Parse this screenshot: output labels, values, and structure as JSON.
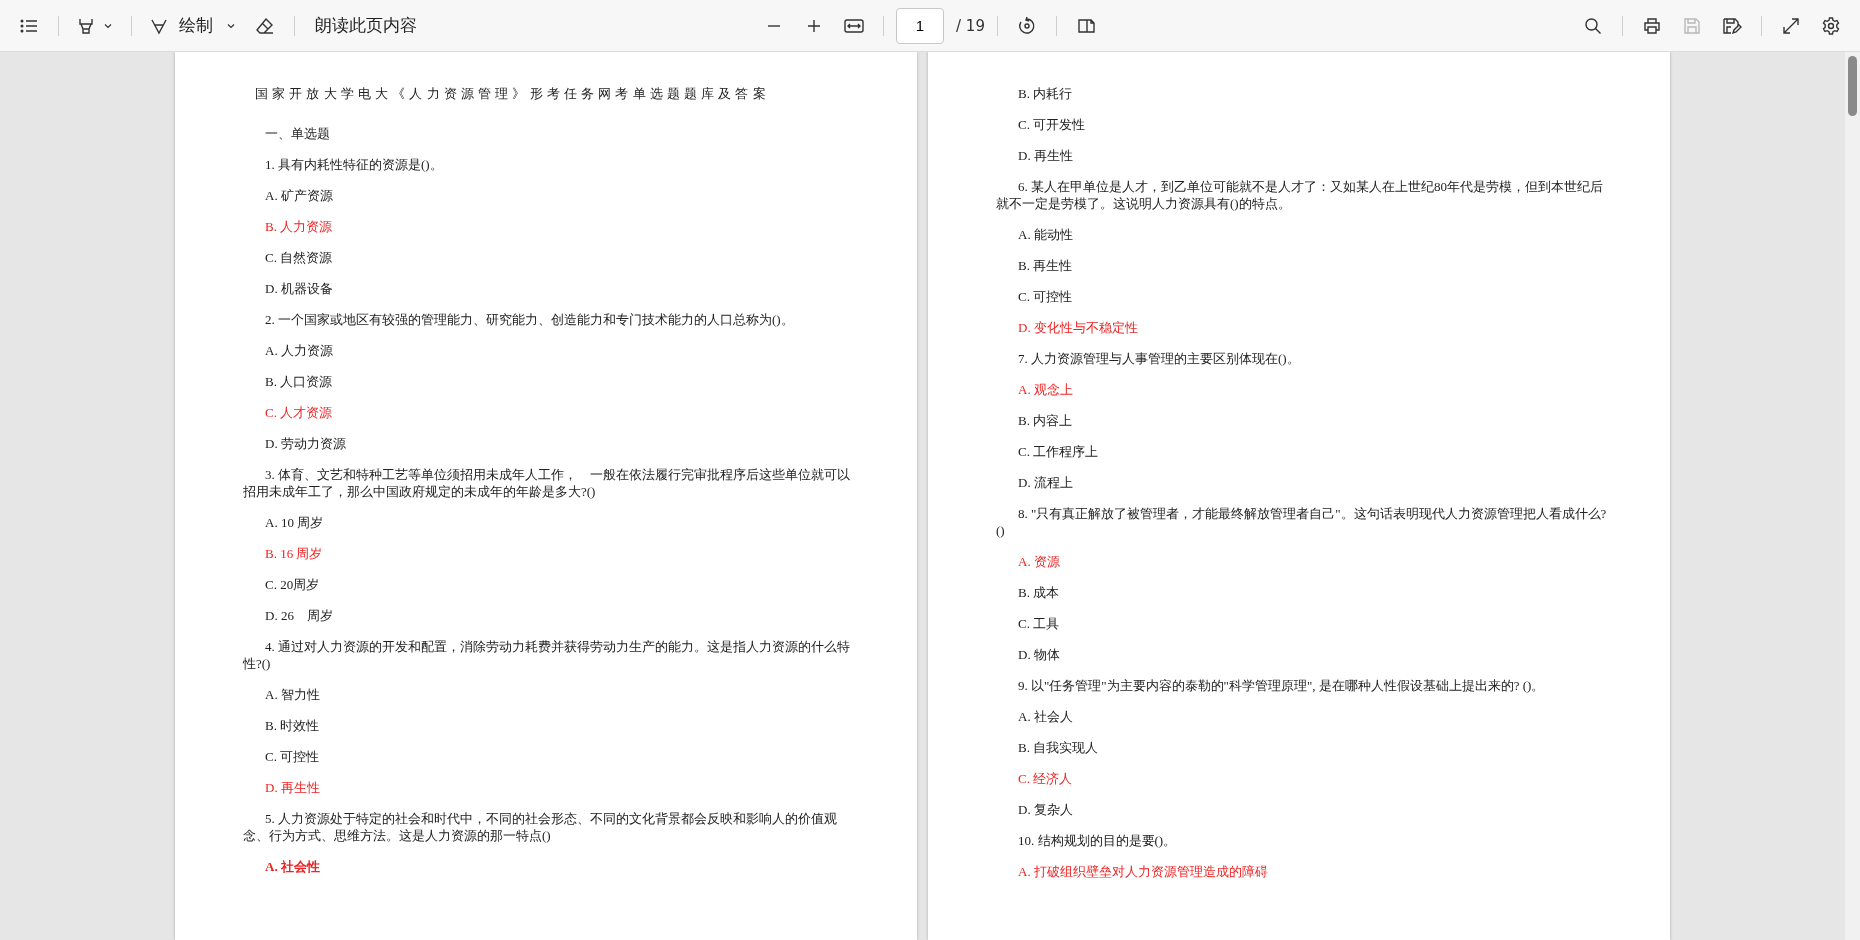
{
  "toolbar": {
    "draw_label": "绘制",
    "read_aloud_label": "朗读此页内容",
    "page_number": "1",
    "page_total": "/ 19",
    "save": {
      "disabled": true
    }
  },
  "pages": [
    {
      "lines": [
        {
          "kind": "title",
          "text": "国家开放大学电大《人力资源管理》形考任务网考单选题题库及答案"
        },
        {
          "kind": "heading",
          "text": "一、单选题"
        },
        {
          "kind": "question",
          "text": "1. 具有内耗性特征的资源是()。"
        },
        {
          "kind": "option",
          "text": "A. 矿产资源"
        },
        {
          "kind": "answer",
          "text": "B. 人力资源"
        },
        {
          "kind": "option",
          "text": "C. 自然资源"
        },
        {
          "kind": "option",
          "text": "D. 机器设备"
        },
        {
          "kind": "question",
          "text": "2. 一个国家或地区有较强的管理能力、研究能力、创造能力和专门技术能力的人口总称为()。"
        },
        {
          "kind": "option",
          "text": "A. 人力资源"
        },
        {
          "kind": "option",
          "text": "B. 人口资源"
        },
        {
          "kind": "answer",
          "text": "C. 人才资源"
        },
        {
          "kind": "option",
          "text": "D. 劳动力资源"
        },
        {
          "kind": "question",
          "text": "3. 体育、文艺和特种工艺等单位须招用未成年人工作，　一般在依法履行完审批程序后这些单位就可以招用未成年工了，那么中国政府规定的未成年的年龄是多大?()"
        },
        {
          "kind": "option",
          "text": "A. 10 周岁"
        },
        {
          "kind": "answer",
          "text": "B. 16 周岁"
        },
        {
          "kind": "option",
          "text": "C. 20周岁"
        },
        {
          "kind": "option",
          "text": "D. 26　周岁"
        },
        {
          "kind": "question",
          "text": "4. 通过对人力资源的开发和配置，消除劳动力耗费并获得劳动力生产的能力。这是指人力资源的什么特性?()"
        },
        {
          "kind": "option",
          "text": "A. 智力性"
        },
        {
          "kind": "option",
          "text": "B. 时效性"
        },
        {
          "kind": "option",
          "text": "C. 可控性"
        },
        {
          "kind": "answer",
          "text": "D. 再生性"
        },
        {
          "kind": "question",
          "text": "5. 人力资源处于特定的社会和时代中，不同的社会形态、不同的文化背景都会反映和影响人的价值观念、行为方式、思维方法。这是人力资源的那一特点()"
        },
        {
          "kind": "strong-answer",
          "text": "A. 社会性"
        }
      ]
    },
    {
      "lines": [
        {
          "kind": "option",
          "text": "B. 内耗行"
        },
        {
          "kind": "option",
          "text": "C. 可开发性"
        },
        {
          "kind": "option",
          "text": "D. 再生性"
        },
        {
          "kind": "question",
          "text": "6. 某人在甲单位是人才，到乙单位可能就不是人才了：又如某人在上世纪80年代是劳模，但到本世纪后就不一定是劳模了。这说明人力资源具有()的特点。"
        },
        {
          "kind": "option",
          "text": "A. 能动性"
        },
        {
          "kind": "option",
          "text": "B. 再生性"
        },
        {
          "kind": "option",
          "text": "C. 可控性"
        },
        {
          "kind": "answer",
          "text": "D. 变化性与不稳定性"
        },
        {
          "kind": "question",
          "text": "7. 人力资源管理与人事管理的主要区别体现在()。"
        },
        {
          "kind": "answer",
          "text": "A. 观念上"
        },
        {
          "kind": "option",
          "text": "B. 内容上"
        },
        {
          "kind": "option",
          "text": "C. 工作程序上"
        },
        {
          "kind": "option",
          "text": "D. 流程上"
        },
        {
          "kind": "question",
          "text": "8. \"只有真正解放了被管理者，才能最终解放管理者自己\"。这句话表明现代人力资源管理把人看成什么?()"
        },
        {
          "kind": "answer",
          "text": "A. 资源"
        },
        {
          "kind": "option",
          "text": "B. 成本"
        },
        {
          "kind": "option",
          "text": "C. 工具"
        },
        {
          "kind": "option",
          "text": "D. 物体"
        },
        {
          "kind": "question",
          "text": "9. 以\"任务管理\"为主要内容的泰勒的\"科学管理原理\", 是在哪种人性假设基础上提出来的? ()。"
        },
        {
          "kind": "option",
          "text": "A. 社会人"
        },
        {
          "kind": "option",
          "text": "B. 自我实现人"
        },
        {
          "kind": "answer",
          "text": "C. 经济人"
        },
        {
          "kind": "option",
          "text": "D. 复杂人"
        },
        {
          "kind": "question",
          "text": "10. 结构规划的目的是要()。"
        },
        {
          "kind": "answer",
          "text": "A. 打破组织壁垒对人力资源管理造成的障碍"
        }
      ]
    }
  ]
}
